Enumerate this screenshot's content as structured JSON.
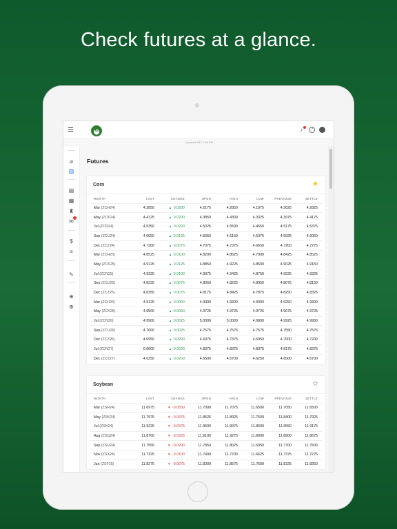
{
  "headline": "Check futures at a glance.",
  "updated": "Updated 5/17 1:26 PM",
  "page_title": "Futures",
  "logo_text": "G",
  "columns": [
    "MONTH",
    "LAST",
    "CHANGE",
    "OPEN",
    "HIGH",
    "LOW",
    "PREVIOUS",
    "SETTLE"
  ],
  "corn": {
    "title": "Corn",
    "favorite": true,
    "rows": [
      {
        "month": "Mar",
        "code": "(ZCH24)",
        "last": "4.2850",
        "change": "0.0200",
        "dir": "up",
        "open": "4.2175",
        "high": "4.2850",
        "low": "4.1975",
        "previous": "4.2625",
        "settle": "4.2825"
      },
      {
        "month": "May",
        "code": "(ZCK24)",
        "last": "4.4125",
        "change": "0.0200",
        "dir": "up",
        "open": "4.3850",
        "high": "4.4300",
        "low": "4.3325",
        "previous": "4.3975",
        "settle": "4.4175"
      },
      {
        "month": "Jul",
        "code": "(ZCN24)",
        "last": "4.5350",
        "change": "0.0200",
        "dir": "up",
        "open": "4.5025",
        "high": "4.5500",
        "low": "4.4550",
        "previous": "4.5175",
        "settle": "4.5375"
      },
      {
        "month": "Sep",
        "code": "(ZCU24)",
        "last": "4.6050",
        "change": "0.0125",
        "dir": "up",
        "open": "4.5650",
        "high": "4.6150",
        "low": "4.5375",
        "previous": "4.5925",
        "settle": "4.6050"
      },
      {
        "month": "Dec",
        "code": "(ZCZ24)",
        "last": "4.7300",
        "change": "0.0075",
        "dir": "up",
        "open": "4.7075",
        "high": "4.7375",
        "low": "4.6650",
        "previous": "4.7200",
        "settle": "4.7275"
      },
      {
        "month": "Mar",
        "code": "(ZCH25)",
        "last": "4.8525",
        "change": "0.0100",
        "dir": "up",
        "open": "4.8200",
        "high": "4.8625",
        "low": "4.7900",
        "previous": "4.8425",
        "settle": "4.8525"
      },
      {
        "month": "May",
        "code": "(ZCK25)",
        "last": "4.9125",
        "change": "0.0125",
        "dir": "up",
        "open": "4.8850",
        "high": "4.9225",
        "low": "4.8500",
        "previous": "4.9025",
        "settle": "4.9150"
      },
      {
        "month": "Jul",
        "code": "(ZCN25)",
        "last": "4.9325",
        "change": "0.0100",
        "dir": "up",
        "open": "4.9075",
        "high": "4.9425",
        "low": "4.8750",
        "previous": "4.9225",
        "settle": "4.9325"
      },
      {
        "month": "Sep",
        "code": "(ZCU25)",
        "last": "4.8225",
        "change": "0.0075",
        "dir": "up",
        "open": "4.8050",
        "high": "4.8225",
        "low": "4.8050",
        "previous": "4.8075",
        "settle": "4.8150"
      },
      {
        "month": "Dec",
        "code": "(ZCZ25)",
        "last": "4.8350",
        "change": "0.0075",
        "dir": "up",
        "open": "4.8175",
        "high": "4.8425",
        "low": "4.7875",
        "previous": "4.8250",
        "settle": "4.8325"
      },
      {
        "month": "Mar",
        "code": "(ZCH26)",
        "last": "4.9125",
        "change": "0.0050",
        "dir": "up",
        "open": "4.9300",
        "high": "4.9300",
        "low": "4.9300",
        "previous": "4.9250",
        "settle": "4.9300"
      },
      {
        "month": "May",
        "code": "(ZCK26)",
        "last": "4.9500",
        "change": "0.0050",
        "dir": "up",
        "open": "4.9725",
        "high": "4.9725",
        "low": "4.9725",
        "previous": "4.9675",
        "settle": "4.9725"
      },
      {
        "month": "Jul",
        "code": "(ZCN26)",
        "last": "4.9900",
        "change": "0.0025",
        "dir": "up",
        "open": "5.0000",
        "high": "5.0000",
        "low": "4.9900",
        "previous": "4.9925",
        "settle": "4.9950"
      },
      {
        "month": "Sep",
        "code": "(ZCU26)",
        "last": "4.7000",
        "change": "0.0025",
        "dir": "up",
        "open": "4.7575",
        "high": "4.7575",
        "low": "4.7575",
        "previous": "4.7550",
        "settle": "4.7575"
      },
      {
        "month": "Dec",
        "code": "(ZCZ26)",
        "last": "4.6950",
        "change": "0.0200",
        "dir": "up",
        "open": "4.6975",
        "high": "4.7375",
        "low": "4.6950",
        "previous": "4.7000",
        "settle": "4.7200"
      },
      {
        "month": "Jul",
        "code": "(ZCN27)",
        "last": "0.0000",
        "change": "0.0200",
        "dir": "up",
        "open": "4.8375",
        "high": "4.8375",
        "low": "4.8375",
        "previous": "4.8175",
        "settle": "4.8375"
      },
      {
        "month": "Dec",
        "code": "(ZCZ27)",
        "last": "4.6250",
        "change": "0.0200",
        "dir": "up",
        "open": "4.6500",
        "high": "4.6700",
        "low": "4.6250",
        "previous": "4.6500",
        "settle": "4.6700"
      }
    ]
  },
  "soybean": {
    "title": "Soybean",
    "favorite": false,
    "rows": [
      {
        "month": "Mar",
        "code": "(ZSH24)",
        "last": "11.6975",
        "change": "-0.0550",
        "dir": "dn",
        "open": "11.7000",
        "high": "11.7075",
        "low": "11.6500",
        "previous": "11.7050",
        "settle": "11.6500"
      },
      {
        "month": "May",
        "code": "(ZSK24)",
        "last": "11.7975",
        "change": "-0.0475",
        "dir": "dn",
        "open": "11.8525",
        "high": "11.8925",
        "low": "11.7500",
        "previous": "11.8400",
        "settle": "11.7925"
      },
      {
        "month": "Jul",
        "code": "(ZSN24)",
        "last": "11.9225",
        "change": "-0.0375",
        "dir": "dn",
        "open": "11.9600",
        "high": "11.9975",
        "low": "11.8600",
        "previous": "11.9550",
        "settle": "11.9175"
      },
      {
        "month": "Aug",
        "code": "(ZSQ24)",
        "last": "11.8700",
        "change": "-0.0225",
        "dir": "dn",
        "open": "11.9100",
        "high": "11.9275",
        "low": "11.8000",
        "previous": "11.8900",
        "settle": "11.8675"
      },
      {
        "month": "Sep",
        "code": "(ZSU24)",
        "last": "11.7550",
        "change": "-0.0200",
        "dir": "dn",
        "open": "11.7850",
        "high": "11.8025",
        "low": "11.6950",
        "previous": "11.7700",
        "settle": "11.7500"
      },
      {
        "month": "Nov",
        "code": "(ZSX24)",
        "last": "11.7325",
        "change": "-0.0100",
        "dir": "dn",
        "open": "11.7400",
        "high": "11.7700",
        "low": "11.6625",
        "previous": "11.7375",
        "settle": "11.7275"
      },
      {
        "month": "Jan",
        "code": "(ZSF25)",
        "last": "11.8275",
        "change": "-0.0075",
        "dir": "dn",
        "open": "11.8300",
        "high": "11.8575",
        "low": "11.7600",
        "previous": "11.8325",
        "settle": "11.8250"
      }
    ]
  }
}
